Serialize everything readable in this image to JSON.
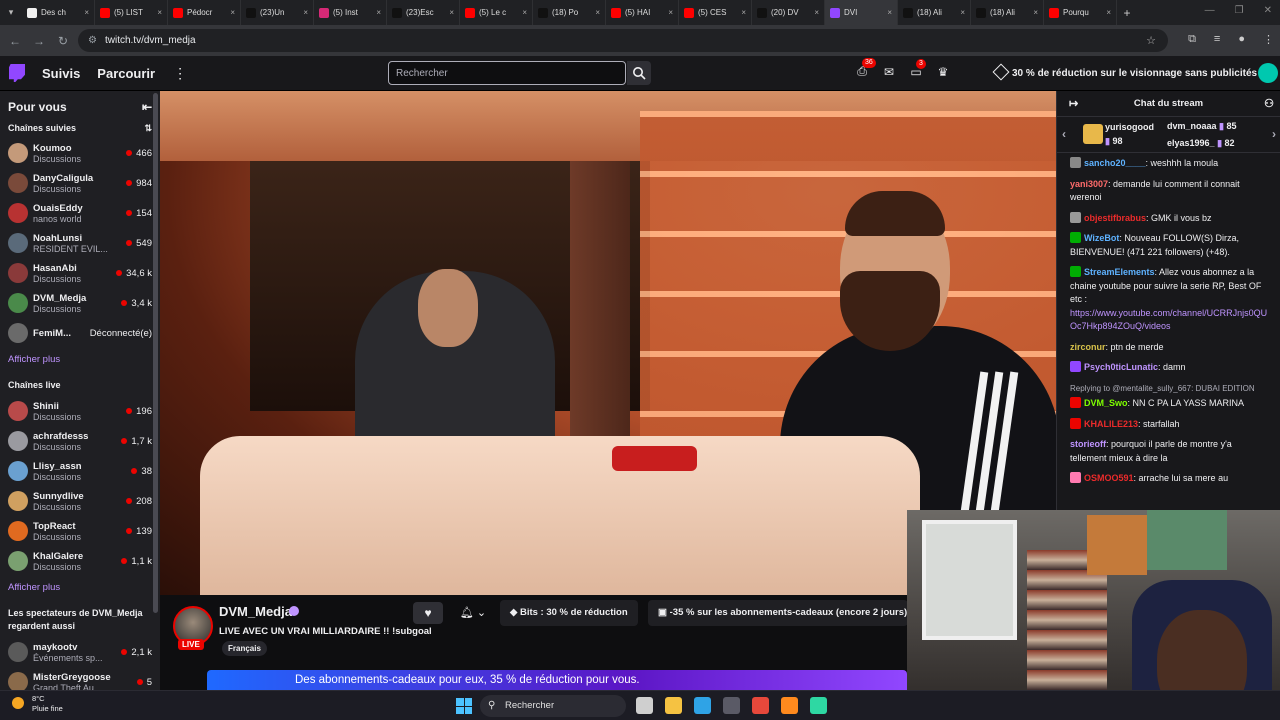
{
  "browser": {
    "tabs": [
      {
        "label": "Des ch",
        "icon": "github-icon",
        "color": "#f0f0f0"
      },
      {
        "label": "(5) LIST",
        "icon": "youtube-icon",
        "color": "#ff0000"
      },
      {
        "label": "Pédocr",
        "icon": "youtube-icon",
        "color": "#ff0000"
      },
      {
        "label": "(23)Un",
        "icon": "tiktok-icon",
        "color": "#111111"
      },
      {
        "label": "(5) Inst",
        "icon": "instagram-icon",
        "color": "#d62976"
      },
      {
        "label": "(23)Esc",
        "icon": "tiktok-icon",
        "color": "#111111"
      },
      {
        "label": "(5) Le c",
        "icon": "youtube-icon",
        "color": "#ff0000"
      },
      {
        "label": "(18) Po",
        "icon": "x-icon",
        "color": "#111111"
      },
      {
        "label": "(5) HAI",
        "icon": "youtube-icon",
        "color": "#ff0000"
      },
      {
        "label": "(5) CES",
        "icon": "youtube-icon",
        "color": "#ff0000"
      },
      {
        "label": "(20) DV",
        "icon": "x-icon",
        "color": "#111111"
      },
      {
        "label": "DVI",
        "icon": "twitch-icon",
        "color": "#9147ff",
        "active": true
      },
      {
        "label": "(18) Ali",
        "icon": "x-icon",
        "color": "#111111"
      },
      {
        "label": "(18) Ali",
        "icon": "x-icon",
        "color": "#111111"
      },
      {
        "label": "Pourqu",
        "icon": "youtube-icon",
        "color": "#ff0000"
      }
    ],
    "url": "twitch.tv/dvm_medja"
  },
  "topnav": {
    "following": "Suivis",
    "browse": "Parcourir",
    "search_placeholder": "Rechercher",
    "inbox_badge": "36",
    "whispers_badge": "3",
    "promo": "30 % de réduction sur le visionnage sans publicités"
  },
  "sidebar": {
    "title": "Pour vous",
    "followed_title": "Chaînes suivies",
    "followed": [
      {
        "name": "Koumoo",
        "game": "Discussions",
        "viewers": "466",
        "color": "#c49a7a"
      },
      {
        "name": "DanyCaligula",
        "game": "Discussions",
        "viewers": "984",
        "color": "#7a4a3a"
      },
      {
        "name": "OuaisEddy",
        "game": "nanos world",
        "viewers": "154",
        "color": "#b83232"
      },
      {
        "name": "NoahLunsi",
        "game": "RESIDENT EVIL...",
        "viewers": "549",
        "color": "#5a6a7a"
      },
      {
        "name": "HasanAbi",
        "game": "Discussions",
        "viewers": "34,6 k",
        "color": "#8a3a3a"
      },
      {
        "name": "DVM_Medja",
        "game": "Discussions",
        "viewers": "3,4 k",
        "color": "#4a8a4a"
      },
      {
        "name": "FemiM...",
        "offline": "Déconnecté(e)",
        "color": "#6a6a6a"
      }
    ],
    "more1": "Afficher plus",
    "live_title": "Chaînes live",
    "live": [
      {
        "name": "Shinii",
        "game": "Discussions",
        "viewers": "196",
        "color": "#b84a4a"
      },
      {
        "name": "achrafdesss",
        "game": "Discussions",
        "viewers": "1,7 k",
        "color": "#9a9aa0"
      },
      {
        "name": "Llisy_assn",
        "game": "Discussions",
        "viewers": "38",
        "color": "#6aa0d0"
      },
      {
        "name": "Sunnydlive",
        "game": "Discussions",
        "viewers": "208",
        "color": "#d0a060"
      },
      {
        "name": "TopReact",
        "game": "Discussions",
        "viewers": "139",
        "color": "#e06a20"
      },
      {
        "name": "KhalGalere",
        "game": "Discussions",
        "viewers": "1,1 k",
        "color": "#7aa070"
      }
    ],
    "more2": "Afficher plus",
    "also_title": "Les spectateurs de DVM_Medja regardent aussi",
    "also": [
      {
        "name": "maykootv",
        "game": "Événements sp...",
        "viewers": "2,1 k",
        "color": "#5a5a5a"
      },
      {
        "name": "MisterGreygoose",
        "game": "Grand Theft Au...",
        "viewers": "5",
        "color": "#8a6a4a"
      }
    ]
  },
  "stream": {
    "channel": "DVM_Medja",
    "live_label": "LIVE",
    "title": "LIVE AVEC UN VRAI MILLIARDAIRE !! !subgoal",
    "tag": "Français",
    "bits_label": "Bits : 30 % de réduction",
    "gift_label": "-35 % sur les abonnements-cadeaux (encore 2 jours)",
    "banner": "Des abonnements-cadeaux pour eux, 35 % de réduction pour vous."
  },
  "chat": {
    "title": "Chat du stream",
    "leaderboard": {
      "gift_user": "yurisogood",
      "gift_count": "98",
      "user2": "dvm_noaaa",
      "count2": "85",
      "user3": "elyas1996_",
      "count3": "82"
    },
    "messages": [
      {
        "user": "sancho20____",
        "color": "#5eb2ff",
        "text": ": weshhh la moula",
        "badge": "#888888"
      },
      {
        "user": "yani3007",
        "color": "#ff6b6b",
        "text": ": demande lui comment il connait werenoi"
      },
      {
        "user": "objestifbrabus",
        "color": "#eb2b2b",
        "text": ": GMK il vous bz",
        "badge": "#999999"
      },
      {
        "user": "WizeBot",
        "color": "#5eb2ff",
        "text": ": Nouveau FOLLOW(S) Dirza, BIENVENUE! (471 221 followers) (+48).",
        "badge": "#00ad03"
      },
      {
        "user": "StreamElements",
        "color": "#5eb2ff",
        "text": ": Allez vous abonnez a la chaine youtube pour suivre la serie RP, Best OF etc :",
        "link": "https://www.youtube.com/channel/UCRRJnjs0QUOc7Hkp894ZOuQ/videos",
        "badge": "#00ad03"
      },
      {
        "user": "zirconur",
        "color": "#d6c14a",
        "text": ": ptn de merde"
      },
      {
        "user": "Psych0ticLunatic",
        "color": "#bf94ff",
        "text": ": damn",
        "badge": "#9147ff"
      },
      {
        "reply": "Replying to @mentalite_sully_667: DUBAI EDITION",
        "user": "DVM_Swo",
        "color": "#7fff00",
        "text": ": NN C PA LA YASS MARINA",
        "badge": "#eb0400"
      },
      {
        "user": "KHALILE213",
        "color": "#eb2b2b",
        "text": ": starfallah",
        "badge": "#eb0400"
      },
      {
        "user": "storieoff",
        "color": "#bf94ff",
        "text": ": pourquoi il parle de montre y'a tellement mieux à dire la"
      },
      {
        "user": "OSMOO591",
        "color": "#eb2b2b",
        "text": ": arrache lui sa mere au",
        "badge": "#ff7ab0"
      }
    ]
  },
  "taskbar": {
    "temp": "8°C",
    "weather": "Pluie fine",
    "search": "Rechercher",
    "apps": [
      {
        "icon": "task-view-icon",
        "color": "#cfcfcf"
      },
      {
        "icon": "file-explorer-icon",
        "color": "#f5c242"
      },
      {
        "icon": "edge-icon",
        "color": "#2fa3e6"
      },
      {
        "icon": "calculator-icon",
        "color": "#5a5a66"
      },
      {
        "icon": "chrome-icon",
        "color": "#e7483b"
      },
      {
        "icon": "firefox-icon",
        "color": "#ff8a1e"
      },
      {
        "icon": "app-icon",
        "color": "#2ed8a3"
      }
    ]
  }
}
